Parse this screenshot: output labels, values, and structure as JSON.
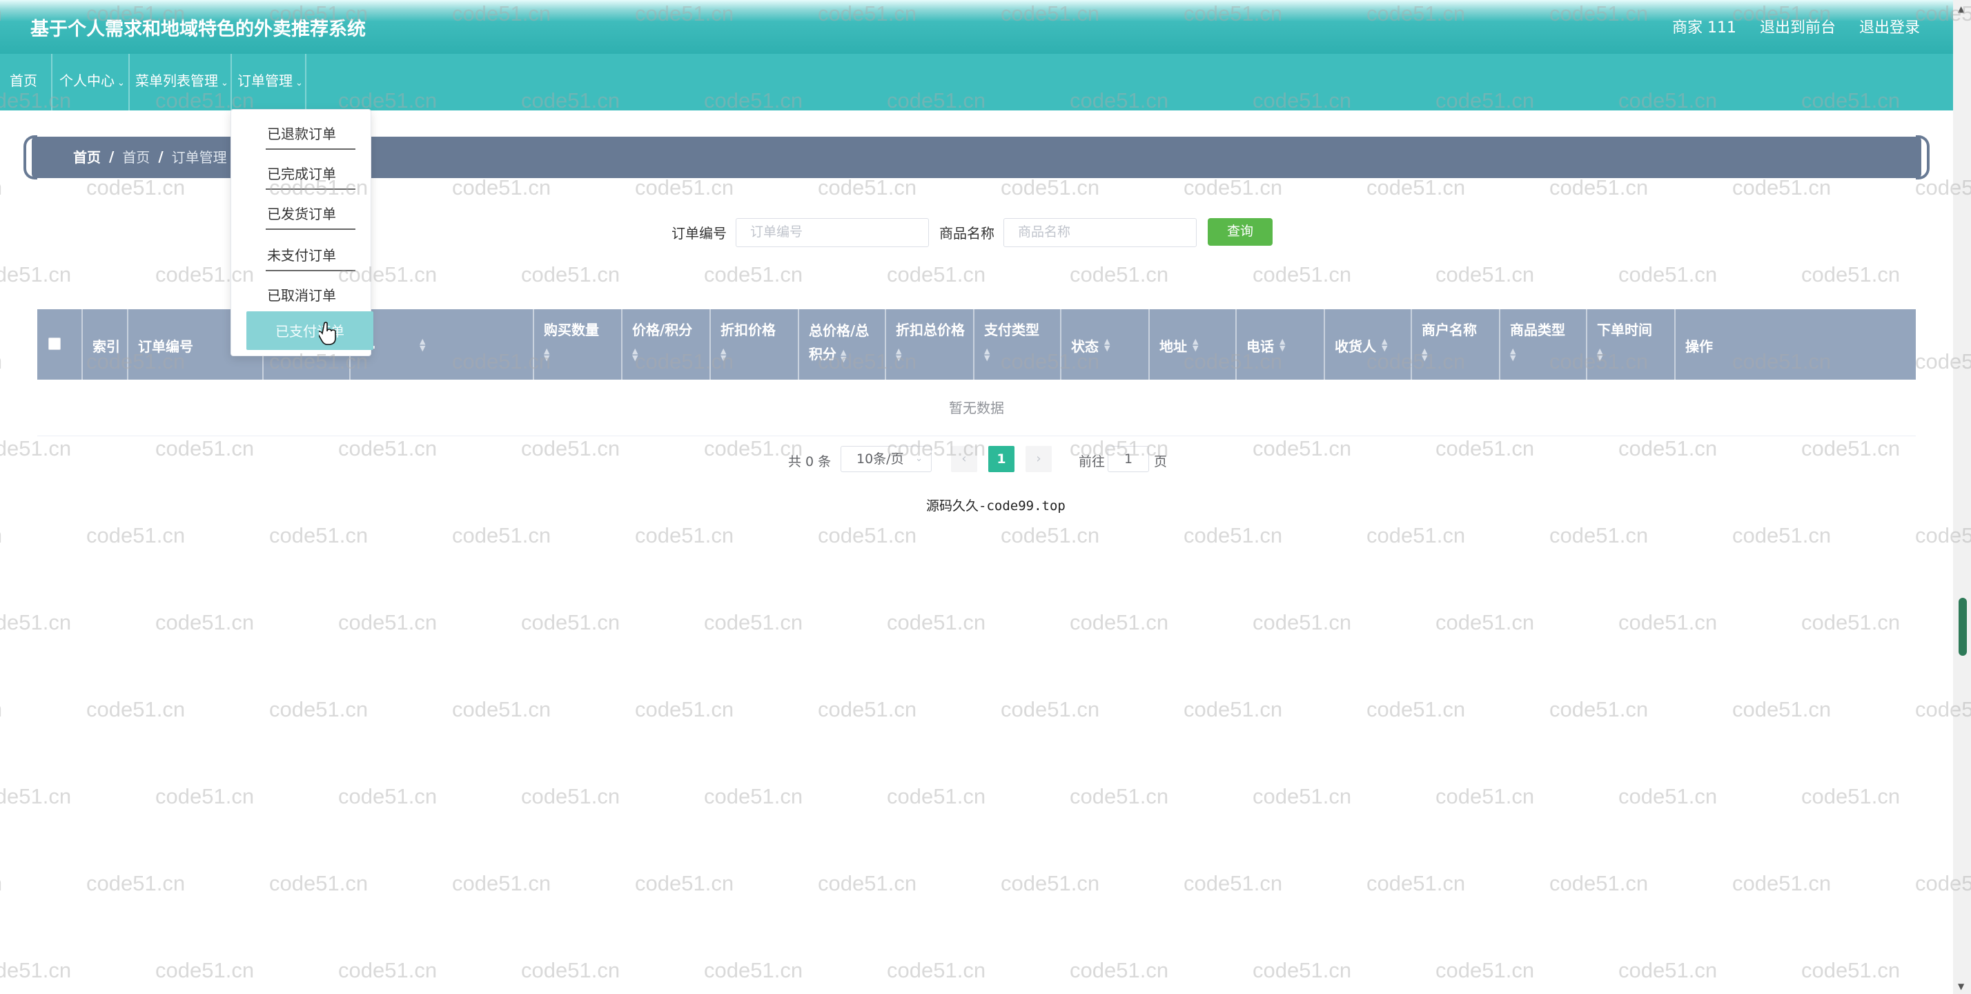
{
  "header": {
    "title": "基于个人需求和地域特色的外卖推荐系统",
    "user": "商家 111",
    "to_front": "退出到前台",
    "logout": "退出登录"
  },
  "nav": {
    "items": [
      {
        "label": "首页"
      },
      {
        "label": "个人中心"
      },
      {
        "label": "菜单列表管理"
      },
      {
        "label": "订单管理"
      }
    ]
  },
  "dropdown": {
    "items": [
      {
        "label": "已退款订单"
      },
      {
        "label": "已完成订单"
      },
      {
        "label": "已发货订单"
      },
      {
        "label": "未支付订单"
      },
      {
        "label": "已取消订单"
      },
      {
        "label": "已支付订单"
      }
    ]
  },
  "breadcrumb": {
    "home": "首页",
    "level1": "首页",
    "level2": "订单管理",
    "separator": "/"
  },
  "search": {
    "order_no_label": "订单编号",
    "order_no_placeholder": "订单编号",
    "product_label": "商品名称",
    "product_placeholder": "商品名称",
    "query_button": "查询"
  },
  "table": {
    "columns": {
      "index": "索引",
      "order_no": "订单编号",
      "col3": "",
      "product_hidden": "...",
      "qty": "购买数量",
      "price": "价格/积分",
      "discount": "折扣价格",
      "total_a": "总价格/总",
      "total_b": "积分",
      "discount_total": "折扣总价格",
      "pay_type": "支付类型",
      "status": "状态",
      "address": "地址",
      "phone": "电话",
      "receiver": "收货人",
      "merchant": "商户名称",
      "product_type": "商品类型",
      "order_time": "下单时间",
      "action": "操作"
    },
    "empty_text": "暂无数据"
  },
  "pagination": {
    "total": "共 0 条",
    "page_size": "10条/页",
    "current_page": "1",
    "goto": "前往",
    "jump_value": "1",
    "unit": "页"
  },
  "footer": {
    "note": "源码久久-code99.top"
  },
  "watermark": {
    "text": "code51.cn"
  },
  "colors": {
    "header": "#3fbdbd",
    "breadcrumb": "#687a94",
    "table_header": "#94a5bd",
    "query": "#5ab84a",
    "active_page": "#2db998",
    "active_dropdown": "#88d3d6"
  }
}
